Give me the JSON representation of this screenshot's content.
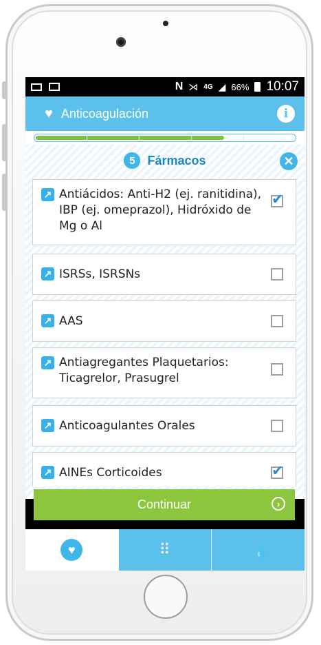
{
  "status_bar": {
    "network": "4G",
    "battery": "66%",
    "time": "10:07"
  },
  "app": {
    "title": "Anticoagulación",
    "info_label": "i"
  },
  "progress": {
    "fraction": 0.72
  },
  "section": {
    "step": "5",
    "title": "Fármacos",
    "close_label": "✕"
  },
  "items": [
    {
      "label": "Antiácidos: Anti-H2 (ej. ranitidina), IBP (ej. omeprazol), Hidróxido de Mg o Al",
      "checked": true
    },
    {
      "label": "ISRSs, ISRSNs",
      "checked": false
    },
    {
      "label": "AAS",
      "checked": false
    },
    {
      "label": "Antiagregantes Plaquetarios: Ticagrelor, Prasugrel",
      "checked": false
    },
    {
      "label": "Anticoagulantes Orales",
      "checked": false
    },
    {
      "label": "AINEs Corticoides",
      "checked": true
    }
  ],
  "continue_button": {
    "label": "Continuar"
  },
  "tabs": [
    {
      "icon": "heart-icon",
      "active": true
    },
    {
      "icon": "dots-grid-icon",
      "active": false
    },
    {
      "icon": "drop-icon",
      "active": false
    }
  ],
  "colors": {
    "accent": "#5bc0ec",
    "progress": "#7ec23f",
    "continue": "#8cc63f",
    "section_title": "#1d87c4"
  }
}
